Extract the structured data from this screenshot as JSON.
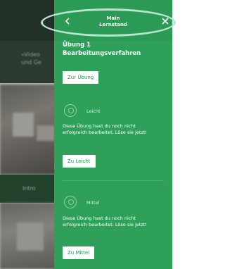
{
  "background": {
    "text_line1": "«Video",
    "text_line2": "und Ge",
    "intro_label": "Intro"
  },
  "panel": {
    "header_title_line1": "Main",
    "header_title_line2": "Lernstand",
    "back_icon": "chevron-left-icon",
    "close_icon": "close-icon",
    "exercise_title_line1": "Übung 1",
    "exercise_title_line2": "Bearbeitungsverfahren",
    "main_button": "Zur Übung",
    "levels": [
      {
        "label": "Leicht",
        "description": "Diese Übung hast du noch nicht erfolgreich bearbeitet. Löse sie jetzt!",
        "button": "Zu Leicht"
      },
      {
        "label": "Mittel",
        "description": "Diese Übung hast du noch nicht erfolgreich bearbeitet. Löse sie jetzt!",
        "button": "Zu Mittel"
      }
    ]
  },
  "colors": {
    "panel_green": "#2fa05a",
    "header_green": "#2a9a55",
    "highlight_ring": "#b9e4cd"
  }
}
